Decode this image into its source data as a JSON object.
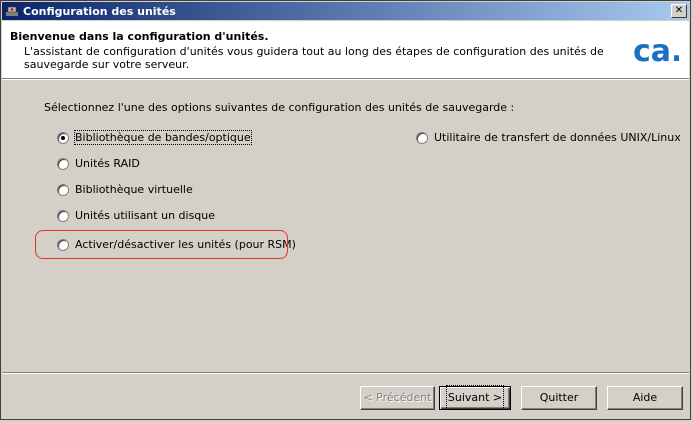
{
  "window": {
    "title": "Configuration des unités",
    "close_label": "✕"
  },
  "header": {
    "title": "Bienvenue dans la configuration d'unités.",
    "description": "L'assistant de configuration d'unités vous guidera tout au long des étapes de configuration des unités de sauvegarde sur votre serveur.",
    "logo_text": "ca."
  },
  "prompt": "Sélectionnez l'une des options suivantes de configuration des unités de sauvegarde :",
  "options": [
    {
      "label": "Bibliothèque de bandes/optique",
      "checked": true
    },
    {
      "label": "Unités RAID",
      "checked": false
    },
    {
      "label": "Bibliothèque virtuelle",
      "checked": false
    },
    {
      "label": "Unités utilisant un disque",
      "checked": false
    },
    {
      "label": "Activer/désactiver les unités (pour RSM)",
      "checked": false
    },
    {
      "label": "Utilitaire de transfert de données UNIX/Linux",
      "checked": false
    }
  ],
  "buttons": {
    "previous": "< Précédent",
    "next": "Suivant >",
    "quit": "Quitter",
    "help": "Aide"
  },
  "colors": {
    "title_gradient_start": "#0a246a",
    "title_gradient_end": "#a6caf0",
    "highlight": "#e03030",
    "logo_blue": "#1c6fc4"
  }
}
